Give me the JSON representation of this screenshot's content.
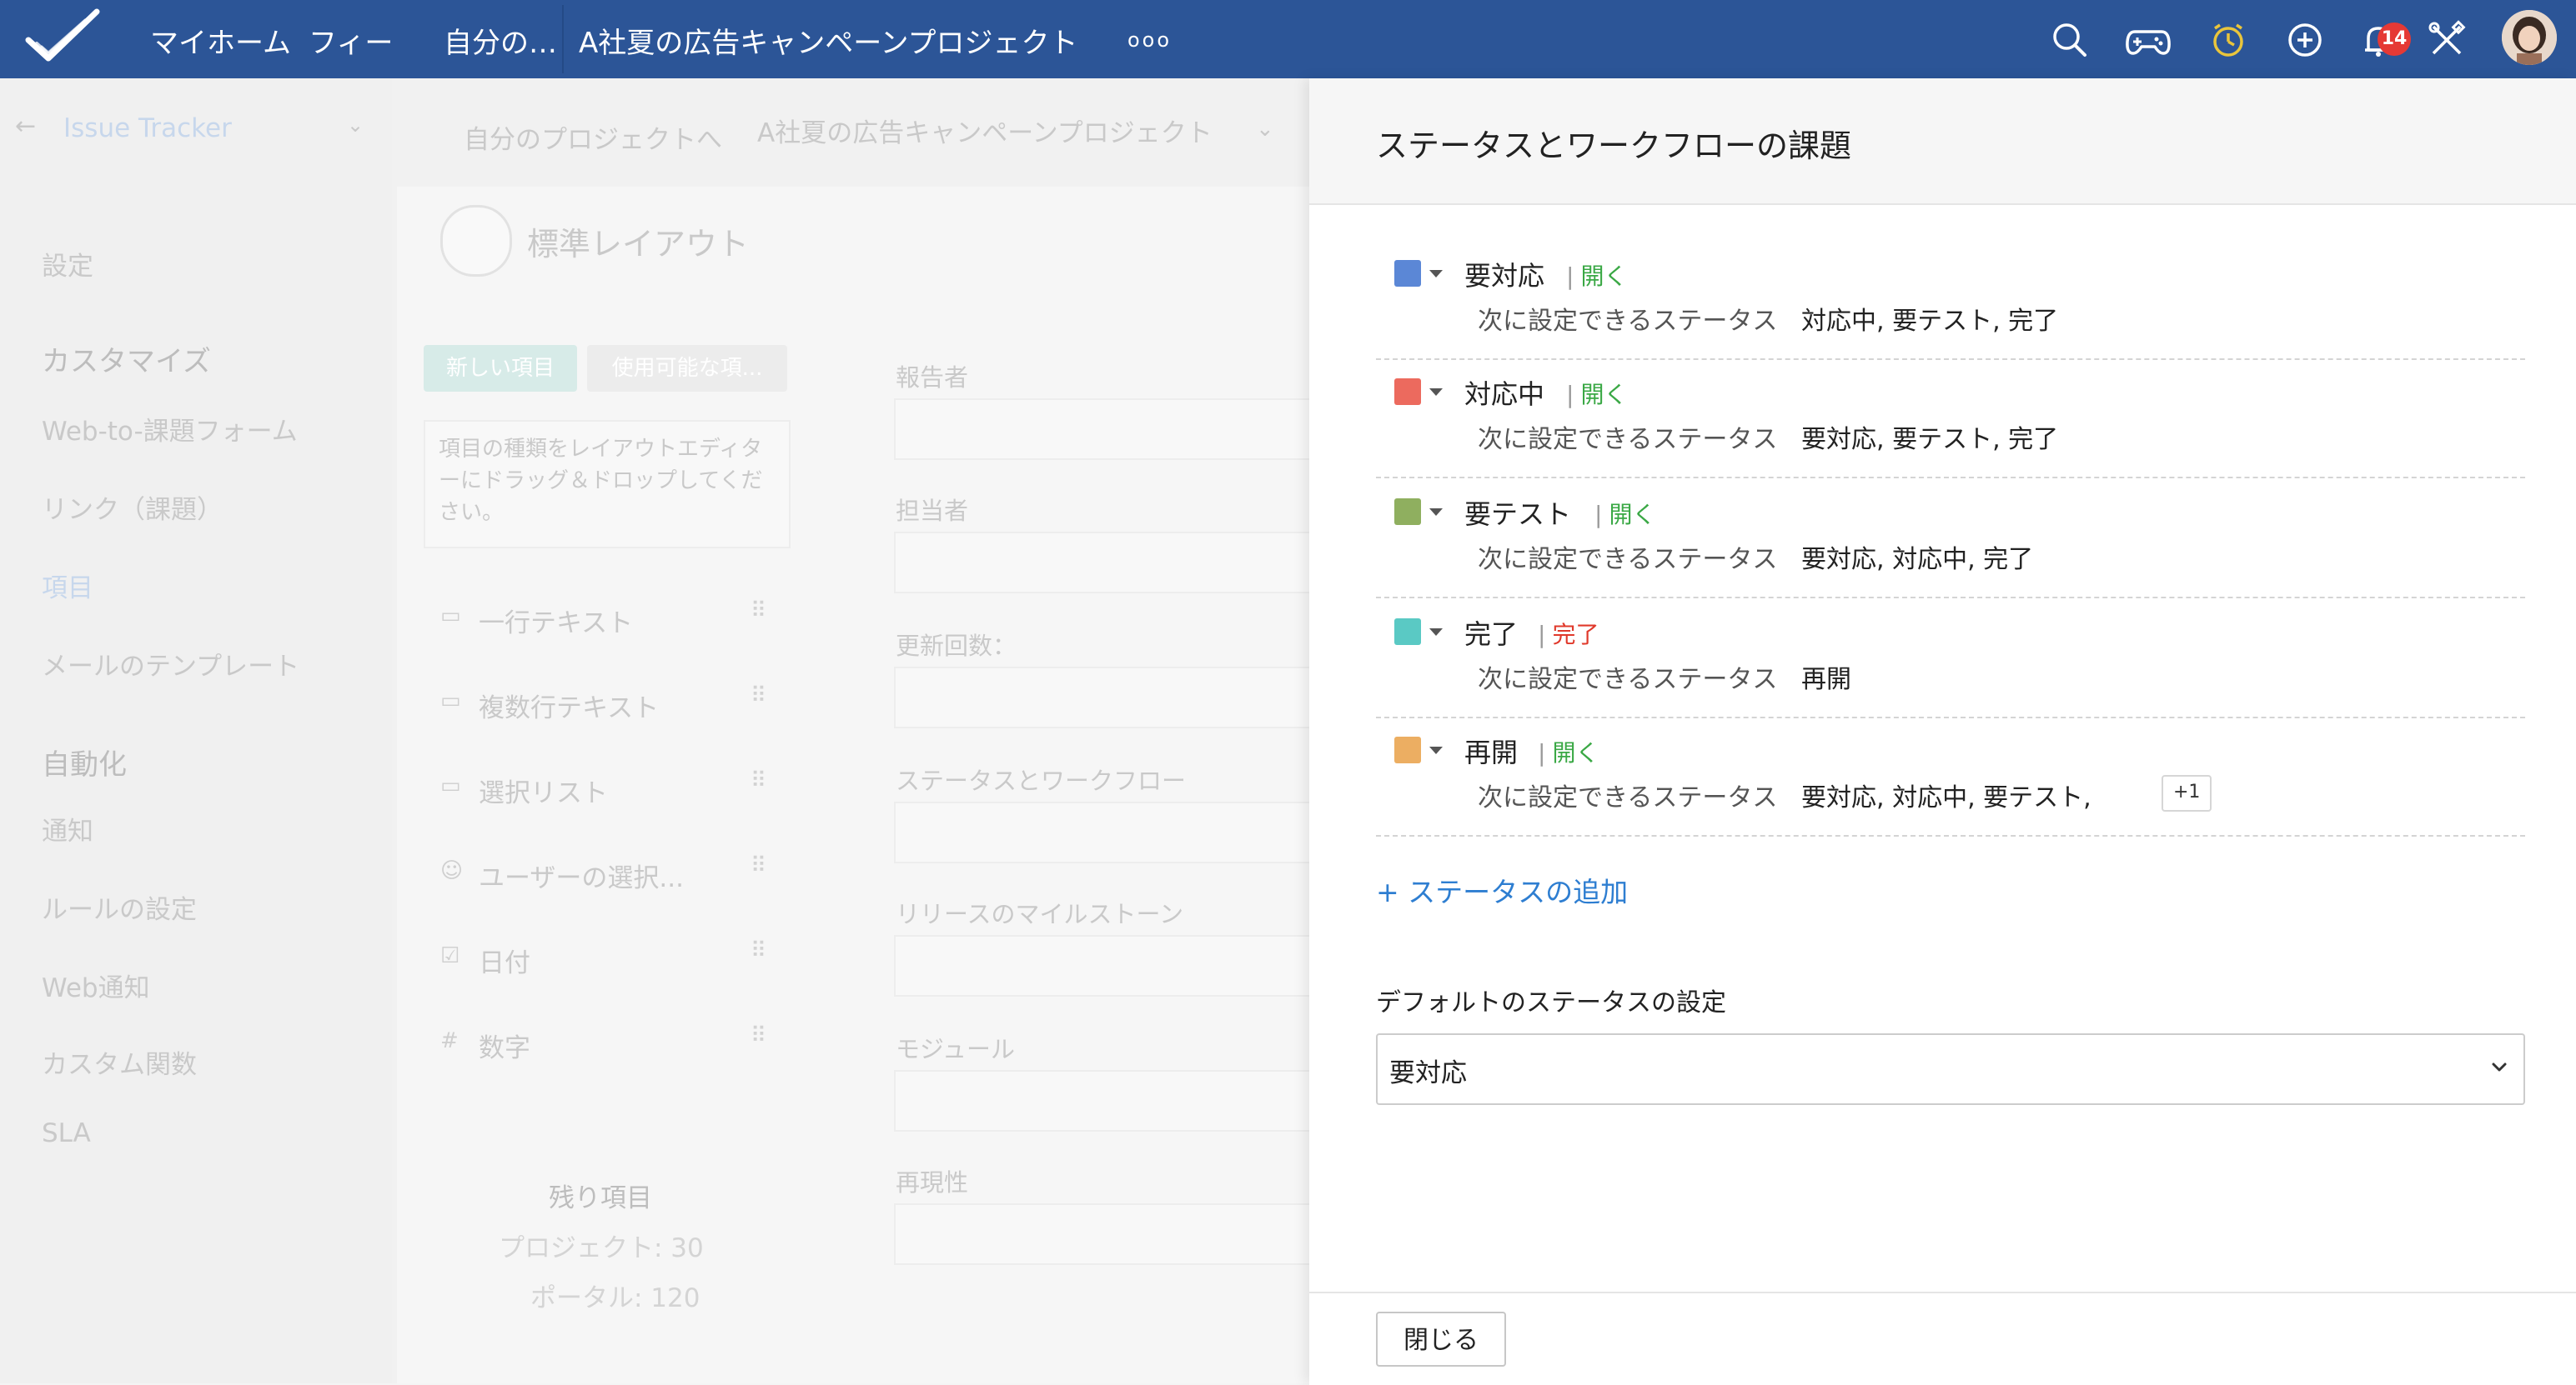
{
  "topbar": {
    "nav_home": "マイホーム",
    "nav_feed": "フィー",
    "nav_mine": "自分の…",
    "nav_project": "A社夏の広告キャンペーンプロジェクト",
    "more_dots": "ooo",
    "notification_count": "14"
  },
  "background": {
    "app_name": "Issue Tracker",
    "breadcrumb_back": "自分のプロジェクトへ",
    "project_title": "A社夏の広告キャンペーンプロジェクト",
    "sidebar": {
      "settings": "設定",
      "customize": "カスタマイズ",
      "web_to_issue": "Web-to-課題フォーム",
      "links": "リンク（課題）",
      "fields": "項目",
      "mail_templates": "メールのテンプレート",
      "automation": "自動化",
      "notifications": "通知",
      "rules": "ルールの設定",
      "web_notifications": "Web通知",
      "custom_functions": "カスタム関数",
      "sla": "SLA"
    },
    "layout_title": "標準レイアウト",
    "tab_new": "新しい項目",
    "tab_available": "使用可能な項...",
    "drag_hint": "項目の種類をレイアウトエディターにドラッグ＆ドロップしてください。",
    "field_types": [
      {
        "label": "一行テキスト"
      },
      {
        "label": "複数行テキスト"
      },
      {
        "label": "選択リスト"
      },
      {
        "label": "ユーザーの選択..."
      },
      {
        "label": "日付"
      },
      {
        "label": "数字"
      }
    ],
    "remaining_title": "残り項目",
    "remaining_project": "プロジェクト: 30",
    "remaining_portal": "ポータル: 120",
    "form_fields": [
      {
        "label": "報告者"
      },
      {
        "label": "担当者"
      },
      {
        "label": "更新回数："
      },
      {
        "label": "ステータスとワークフロー"
      },
      {
        "label": "リリースのマイルストーン"
      },
      {
        "label": "モジュール"
      },
      {
        "label": "再現性"
      }
    ]
  },
  "panel": {
    "title": "ステータスとワークフローの課題",
    "next_label": "次に設定できるステータス",
    "statuses": [
      {
        "name": "要対応",
        "type": "開く",
        "type_color": "#3aa845",
        "color": "#5b87d6",
        "next": "対応中, 要テスト, 完了",
        "extra": ""
      },
      {
        "name": "対応中",
        "type": "開く",
        "type_color": "#3aa845",
        "color": "#ec6a5e",
        "next": "要対応, 要テスト, 完了",
        "extra": ""
      },
      {
        "name": "要テスト",
        "type": "開く",
        "type_color": "#3aa845",
        "color": "#8faf5f",
        "next": "要対応, 対応中, 完了",
        "extra": ""
      },
      {
        "name": "完了",
        "type": "完了",
        "type_color": "#e0392b",
        "color": "#5ac9c4",
        "next": "再開",
        "extra": ""
      },
      {
        "name": "再開",
        "type": "開く",
        "type_color": "#3aa845",
        "color": "#ecae62",
        "next": "要対応, 対応中, 要テスト,",
        "extra": "+1"
      }
    ],
    "add_status": "+ ステータスの追加",
    "default_label": "デフォルトのステータスの設定",
    "default_value": "要対応",
    "close_button": "閉じる"
  }
}
